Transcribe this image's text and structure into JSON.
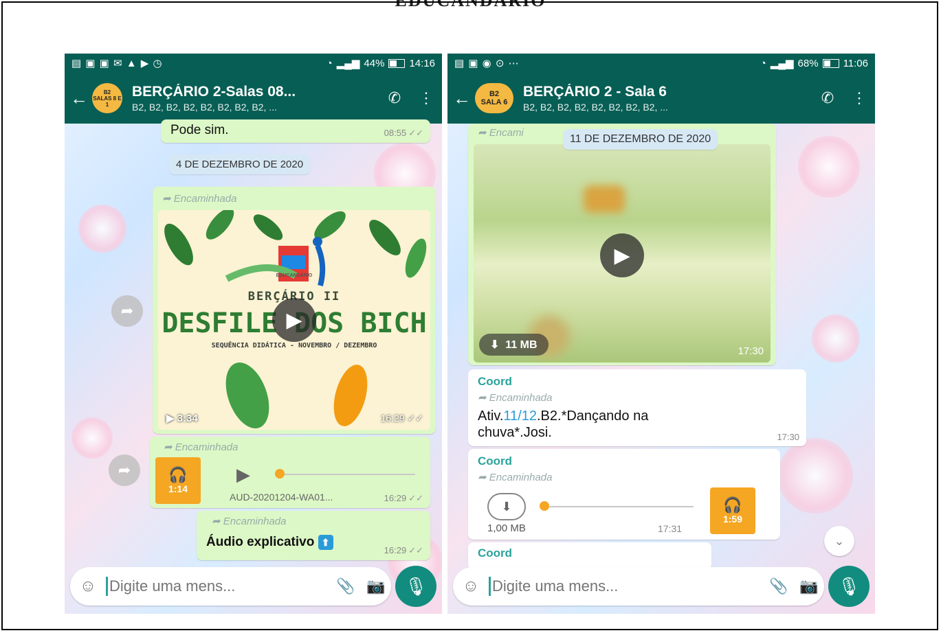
{
  "doc_title": "EDUCANDÁRIO",
  "left": {
    "status": {
      "battery": "44%",
      "time": "14:16"
    },
    "header": {
      "avatar_top": "B2",
      "avatar_bottom": "SALAS 8 E 1",
      "title": "BERÇÁRIO 2-Salas 08...",
      "subtitle": "B2, B2, B2, B2, B2, B2, B2, B2, ..."
    },
    "messages": {
      "m1_text": "Pode sim.",
      "m1_time": "08:55",
      "date": "4 DE DEZEMBRO DE 2020",
      "forwarded": "Encaminhada",
      "video": {
        "t1": "BERÇÁRIO II",
        "t2": "DESFILE DOS BICH",
        "t3": "SEQUÊNCIA DIDÁTICA - NOVEMBRO / DEZEMBRO",
        "logo": "EDUCANDÁRIO",
        "duration": "3:34",
        "time": "16:29"
      },
      "audio": {
        "duration": "1:14",
        "filename": "AUD-20201204-WA01...",
        "time": "16:29"
      },
      "m3_text": "Áudio explicativo",
      "m3_time": "16:29"
    },
    "composer": {
      "placeholder": "Digite uma mens..."
    }
  },
  "right": {
    "status": {
      "battery": "68%",
      "time": "11:06"
    },
    "header": {
      "avatar_top": "B2",
      "avatar_bottom": "SALA 6",
      "title": "BERÇÁRIO 2 - Sala 6",
      "subtitle": "B2, B2, B2, B2, B2, B2, B2, B2, ..."
    },
    "messages": {
      "forwarded_short": "Encami",
      "forwarded": "Encaminhada",
      "date": "11 DE DEZEMBRO DE 2020",
      "video": {
        "size": "11 MB",
        "time": "17:30"
      },
      "sender": "Coord",
      "m2_prefix": "Ativ.",
      "m2_link1": "11",
      "m2_slash": "/",
      "m2_link2": "12",
      "m2_suffix": ".B2.*Dançando na",
      "m2_line2": "chuva*.Josi.",
      "m2_time": "17:30",
      "audio": {
        "size": "1,00 MB",
        "time": "17:31",
        "duration": "1:59"
      }
    },
    "composer": {
      "placeholder": "Digite uma mens..."
    }
  },
  "colors": {
    "header": "#075e54",
    "bubble": "#dcf8c6",
    "accent": "#f5a623",
    "mic": "#128c7e"
  }
}
